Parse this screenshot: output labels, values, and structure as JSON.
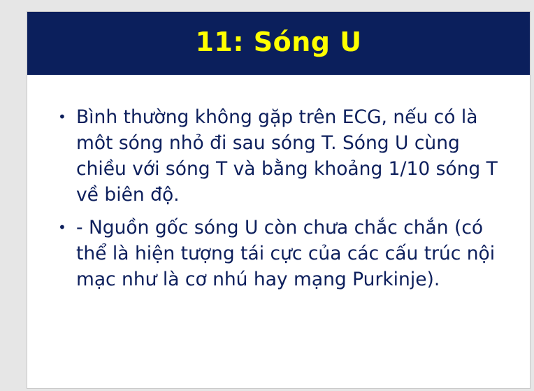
{
  "slide": {
    "title": "11: Sóng U",
    "bullets": [
      {
        "text": "Bình thường không gặp trên ECG, nếu có là môt sóng nhỏ đi sau sóng T. Sóng U cùng chiều với sóng T và bằng khoảng 1/10 sóng T về biên độ."
      },
      {
        "text": "- Nguồn gốc sóng U còn chưa chắc chắn (có thể là hiện tượng tái cực của các cấu trúc nội mạc như là cơ nhú hay mạng Purkinje)."
      }
    ],
    "bullet_glyph": "•"
  },
  "colors": {
    "title_bar": "#0b1f5c",
    "title_text": "#ffff00",
    "body_text": "#0d1f5c",
    "background": "#ffffff"
  }
}
